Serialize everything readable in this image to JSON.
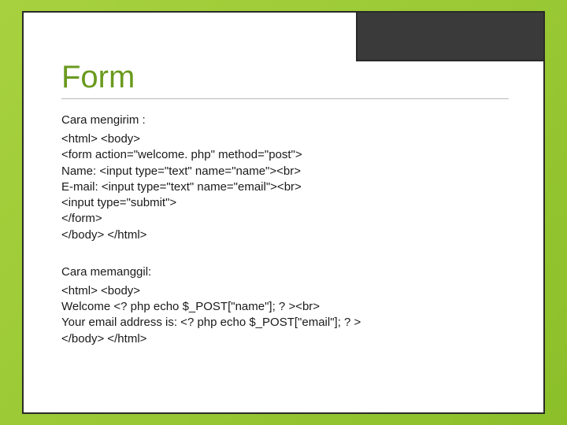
{
  "slide": {
    "title": "Form",
    "section1": {
      "label": "Cara mengirim :",
      "lines": [
        "<html> <body>",
        "<form action=\"welcome. php\" method=\"post\">",
        "Name: <input type=\"text\" name=\"name\"><br>",
        "E-mail: <input type=\"text\" name=\"email\"><br>",
        "<input type=\"submit\">",
        "</form>",
        "</body> </html>"
      ]
    },
    "section2": {
      "label": "Cara memanggil:",
      "lines": [
        "<html> <body>",
        "Welcome <? php echo $_POST[\"name\"]; ? ><br>",
        "Your email address is: <? php echo $_POST[\"email\"]; ? >",
        "</body> </html>"
      ]
    }
  }
}
